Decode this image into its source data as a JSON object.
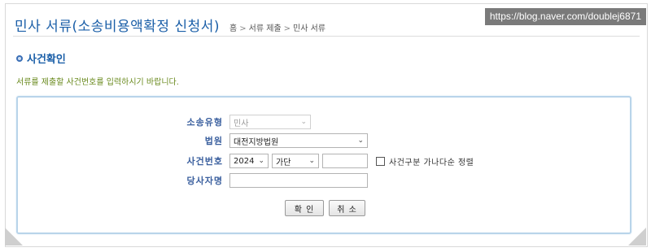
{
  "header": {
    "title": "민사 서류(소송비용액확정 신청서)",
    "breadcrumb": [
      "홈",
      "서류 제출",
      "민사 서류"
    ],
    "separator": ">"
  },
  "watermark": "https://blog.naver.com/doublej6871",
  "section": {
    "title": "사건확인",
    "guide": "서류를 제출할 사건번호를 입력하시기 바랍니다."
  },
  "form": {
    "case_type": {
      "label": "소송유형",
      "value": "민사"
    },
    "court": {
      "label": "법원",
      "value": "대전지방법원"
    },
    "case_number": {
      "label": "사건번호",
      "year": "2024",
      "type": "가단",
      "serial": "",
      "sort_label": "사건구분 가나다순 정렬"
    },
    "party_name": {
      "label": "당사자명",
      "value": ""
    },
    "confirm_button": "확 인",
    "cancel_button": "취 소"
  },
  "colors": {
    "title": "#1b5fa8",
    "guide": "#6a8a1e",
    "panel_border": "#b8d4ea"
  }
}
